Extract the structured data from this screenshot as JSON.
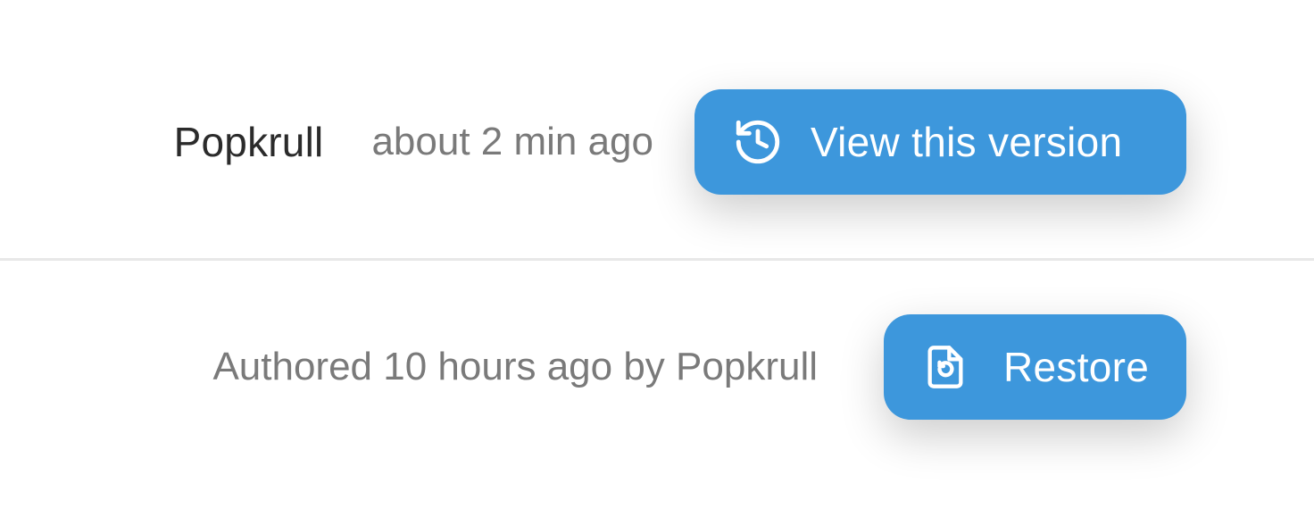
{
  "version_row": {
    "author": "Popkrull",
    "time": "about 2 min ago",
    "view_button_label": "View this version",
    "view_button_icon": "history-icon"
  },
  "restore_row": {
    "meta": "Authored 10 hours ago by Popkrull",
    "restore_button_label": "Restore",
    "restore_button_icon": "file-restore-icon"
  },
  "colors": {
    "button_bg": "#3d97dc",
    "button_text": "#ffffff",
    "author_text": "#2b2b2b",
    "muted_text": "#7a7a7a",
    "divider": "#e8e8e8"
  }
}
